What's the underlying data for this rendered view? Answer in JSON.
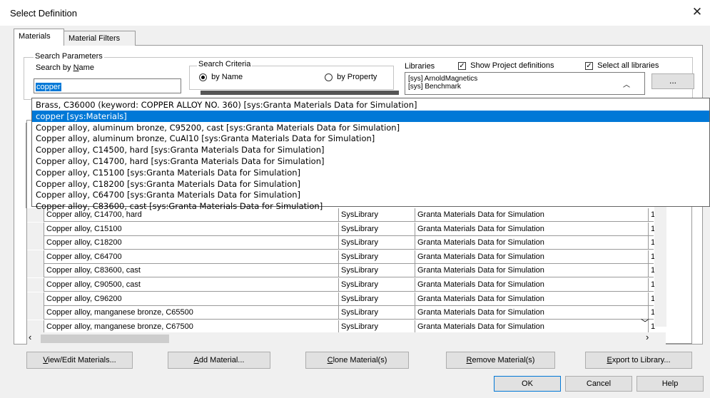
{
  "window": {
    "title": "Select Definition",
    "close_glyph": "✕"
  },
  "tabs": [
    "Materials",
    "Material Filters"
  ],
  "search": {
    "group_label": "Search Parameters",
    "search_by_name_label_pre": "Search by ",
    "search_by_name_label_ul": "N",
    "search_by_name_label_post": "ame",
    "value": "copper",
    "criteria_label": "Search Criteria",
    "by_name": "by Name",
    "by_property": "by Property",
    "libraries_label": "Libraries",
    "show_project_definitions": "Show Project definitions",
    "select_all_libraries": "Select all libraries",
    "libraries": [
      "[sys] ArnoldMagnetics",
      "[sys] Benchmark"
    ],
    "browse_label": "..."
  },
  "dropdown": {
    "items": [
      "Brass, C36000 (keyword: COPPER ALLOY NO. 360) [sys:Granta Materials Data for Simulation]",
      "copper [sys:Materials]",
      "Copper alloy, aluminum bronze, C95200, cast [sys:Granta Materials Data for Simulation]",
      "Copper alloy, aluminum bronze, CuAl10 [sys:Granta Materials Data for Simulation]",
      "Copper alloy, C14500, hard [sys:Granta Materials Data for Simulation]",
      "Copper alloy, C14700, hard [sys:Granta Materials Data for Simulation]",
      "Copper alloy, C15100 [sys:Granta Materials Data for Simulation]",
      "Copper alloy, C18200 [sys:Granta Materials Data for Simulation]",
      "Copper alloy, C64700 [sys:Granta Materials Data for Simulation]",
      "Copper alloy, C83600, cast [sys:Granta Materials Data for Simulation]"
    ],
    "selected_index": 1
  },
  "table": {
    "rows": [
      [
        "Copper alloy, C14700, hard",
        "SysLibrary",
        "Granta Materials Data for Simulation",
        "1"
      ],
      [
        "Copper alloy, C15100",
        "SysLibrary",
        "Granta Materials Data for Simulation",
        "1"
      ],
      [
        "Copper alloy, C18200",
        "SysLibrary",
        "Granta Materials Data for Simulation",
        "1"
      ],
      [
        "Copper alloy, C64700",
        "SysLibrary",
        "Granta Materials Data for Simulation",
        "1"
      ],
      [
        "Copper alloy, C83600, cast",
        "SysLibrary",
        "Granta Materials Data for Simulation",
        "1"
      ],
      [
        "Copper alloy, C90500, cast",
        "SysLibrary",
        "Granta Materials Data for Simulation",
        "1"
      ],
      [
        "Copper alloy, C96200",
        "SysLibrary",
        "Granta Materials Data for Simulation",
        "1"
      ],
      [
        "Copper alloy, manganese bronze, C65500",
        "SysLibrary",
        "Granta Materials Data for Simulation",
        "1"
      ],
      [
        "Copper alloy, manganese bronze, C67500",
        "SysLibrary",
        "Granta Materials Data for Simulation",
        "1"
      ]
    ]
  },
  "buttons": {
    "view_edit": {
      "ul": "V",
      "rest": "iew/Edit Materials..."
    },
    "add": {
      "pre": "",
      "ul": "A",
      "rest": "dd Material..."
    },
    "clone": {
      "ul": "C",
      "rest": "lone Material(s)"
    },
    "remove": {
      "ul": "R",
      "rest": "emove Material(s)"
    },
    "export": {
      "pre": "",
      "ul": "E",
      "rest": "xport to Library..."
    },
    "ok": "OK",
    "cancel": "Cancel",
    "help": "Help"
  },
  "icons": {
    "radio": "radio-button",
    "checkbox": "checkbox-checked",
    "scroll_up": "chevron-up-icon",
    "scroll_down": "chevron-down-icon",
    "scroll_left": "chevron-left-icon",
    "scroll_right": "chevron-right-icon"
  },
  "colors": {
    "selection": "#0078d7",
    "dialog_bg": "#f0f0f0"
  }
}
